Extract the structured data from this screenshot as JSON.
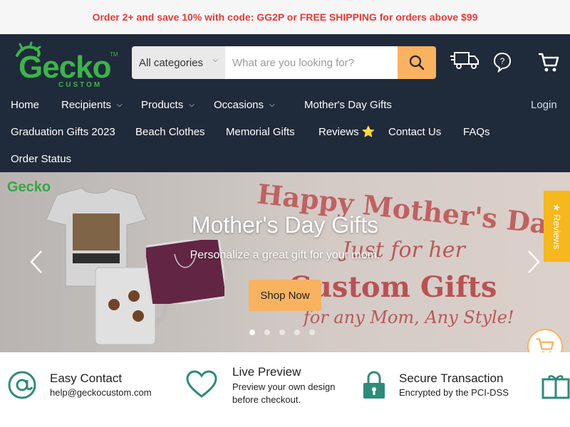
{
  "announcement": "Order 2+ and save 10% with code: GG2P or FREE SHIPPING for orders above $99",
  "brand": {
    "name": "Gecko",
    "subtitle": "CUSTOM",
    "tm": "TM",
    "accent": "#3bb54a"
  },
  "search": {
    "category_label": "All categories",
    "placeholder": "What are you looking for?"
  },
  "header_icons": [
    "shipping-truck-icon",
    "help-chat-icon",
    "cart-icon"
  ],
  "nav": {
    "row1": [
      {
        "label": "Home",
        "dropdown": false
      },
      {
        "label": "Recipients",
        "dropdown": true
      },
      {
        "label": "Products",
        "dropdown": true
      },
      {
        "label": "Occasions",
        "dropdown": true
      },
      {
        "label": "Mother's Day Gifts",
        "dropdown": false
      }
    ],
    "login": "Login",
    "row2": [
      {
        "label": "Graduation Gifts 2023"
      },
      {
        "label": "Beach Clothes"
      },
      {
        "label": "Memorial Gifts"
      },
      {
        "label": "Reviews ⭐"
      },
      {
        "label": "Contact Us"
      },
      {
        "label": "FAQs"
      }
    ],
    "row3": [
      {
        "label": "Order Status"
      }
    ]
  },
  "hero": {
    "title": "Mother's Day Gifts",
    "subtitle": "Personalize a great gift for your mom.",
    "cta": "Shop Now",
    "image_text": {
      "line1": "Happy Mother's Day",
      "line2": "Just for her",
      "line3": "Custom Gifts",
      "line4": "for any Mom, Any Style!"
    },
    "slide_count": 5,
    "active_slide": 1
  },
  "reviews_tab": "★ Reviews",
  "features": [
    {
      "icon": "at-sign-icon",
      "title": "Easy Contact",
      "desc_lines": [
        "help@geckocustom.com"
      ]
    },
    {
      "icon": "heart-icon",
      "title": "Live Preview",
      "desc_lines": [
        "Preview your own design",
        "before checkout."
      ]
    },
    {
      "icon": "lock-icon",
      "title": "Secure Transaction",
      "desc_lines": [
        "Encrypted by the PCI-DSS"
      ]
    },
    {
      "icon": "gift-icon",
      "title": "",
      "desc_lines": []
    }
  ],
  "colors": {
    "header_bg": "#1f2a3a",
    "accent_orange": "#f9b25f",
    "announcement_red": "#e53935",
    "icon_teal": "#2e8b7a"
  }
}
